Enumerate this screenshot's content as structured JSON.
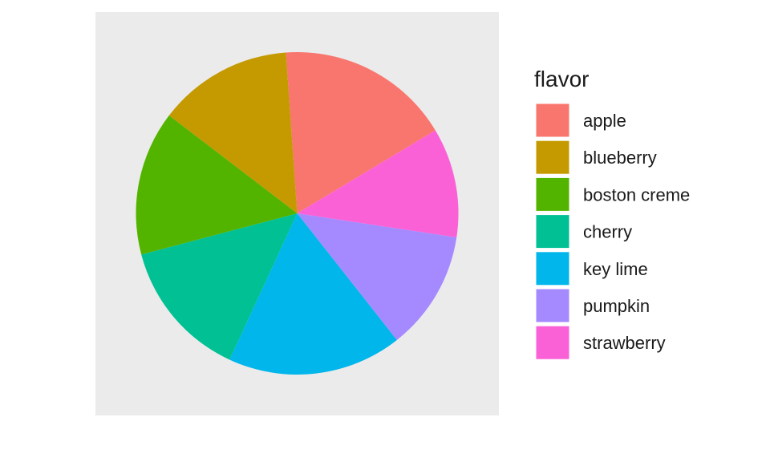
{
  "chart_data": {
    "type": "pie",
    "title": "",
    "legend_title": "flavor",
    "legend_position": "right",
    "start_angle_deg": -4,
    "direction": "clockwise",
    "slices": [
      {
        "label": "apple",
        "value": 17.5,
        "color": "#F8766D"
      },
      {
        "label": "strawberry",
        "value": 11.0,
        "color": "#FB61D7"
      },
      {
        "label": "pumpkin",
        "value": 12.0,
        "color": "#A58AFF"
      },
      {
        "label": "key lime",
        "value": 17.5,
        "color": "#00B6EB"
      },
      {
        "label": "cherry",
        "value": 14.0,
        "color": "#00C094"
      },
      {
        "label": "boston creme",
        "value": 14.5,
        "color": "#53B400"
      },
      {
        "label": "blueberry",
        "value": 13.5,
        "color": "#C49A00"
      }
    ],
    "legend_items": [
      {
        "label": "apple",
        "color": "#F8766D"
      },
      {
        "label": "blueberry",
        "color": "#C49A00"
      },
      {
        "label": "boston creme",
        "color": "#53B400"
      },
      {
        "label": "cherry",
        "color": "#00C094"
      },
      {
        "label": "key lime",
        "color": "#00B6EB"
      },
      {
        "label": "pumpkin",
        "color": "#A58AFF"
      },
      {
        "label": "strawberry",
        "color": "#FB61D7"
      }
    ],
    "panel_background": "#EBEBEB"
  }
}
